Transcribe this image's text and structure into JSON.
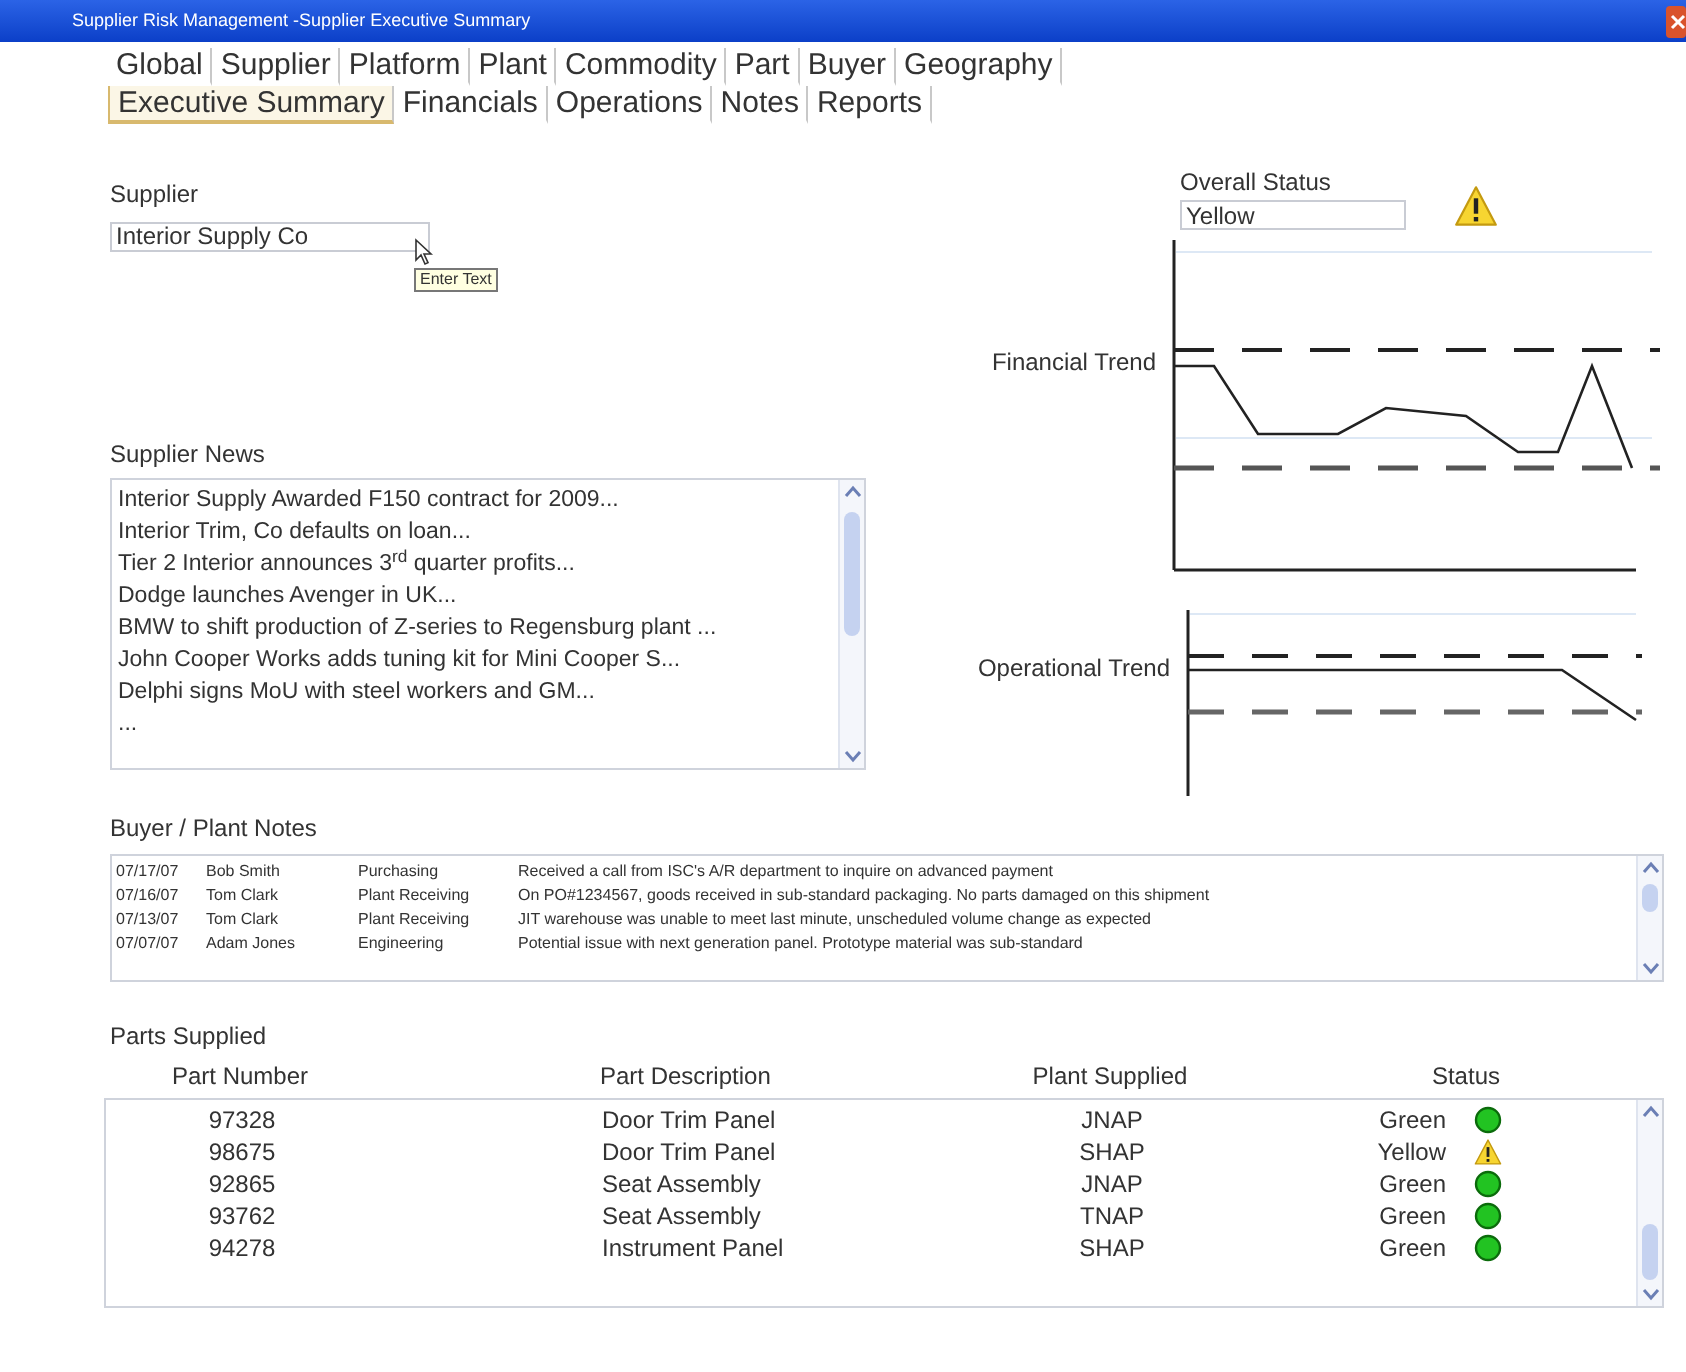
{
  "window": {
    "title": "Supplier Risk Management -Supplier Executive Summary"
  },
  "tab_rows": [
    {
      "tabs": [
        {
          "label": "Global",
          "selected": false
        },
        {
          "label": "Supplier",
          "selected": false
        },
        {
          "label": "Platform",
          "selected": false
        },
        {
          "label": "Plant",
          "selected": false
        },
        {
          "label": "Commodity",
          "selected": false
        },
        {
          "label": "Part",
          "selected": false
        },
        {
          "label": "Buyer",
          "selected": false
        },
        {
          "label": "Geography",
          "selected": false
        }
      ]
    },
    {
      "tabs": [
        {
          "label": "Executive Summary",
          "selected": true
        },
        {
          "label": "Financials",
          "selected": false
        },
        {
          "label": "Operations",
          "selected": false
        },
        {
          "label": "Notes",
          "selected": false
        },
        {
          "label": "Reports",
          "selected": false
        }
      ]
    }
  ],
  "supplier": {
    "label": "Supplier",
    "value": "Interior Supply Co",
    "tooltip": "Enter Text"
  },
  "overall_status": {
    "label": "Overall Status",
    "value": "Yellow",
    "kind": "warning"
  },
  "financial_trend": {
    "label": "Financial Trend"
  },
  "operational_trend": {
    "label": "Operational Trend"
  },
  "supplier_news": {
    "label": "Supplier News",
    "items": [
      "Interior Supply Awarded F150 contract for 2009...",
      "Interior Trim, Co defaults on loan...",
      "Tier 2 Interior announces 3$^{rd}$ quarter profits...",
      "Dodge launches Avenger in UK...",
      "BMW to shift production of Z-series to Regensburg plant ...",
      "John Cooper Works adds tuning kit for Mini Cooper S...",
      "Delphi signs MoU with steel workers and GM...",
      "..."
    ]
  },
  "buyer_plant_notes": {
    "label": "Buyer / Plant Notes",
    "rows": [
      {
        "date": "07/17/07",
        "name": "Bob Smith",
        "department": "Purchasing",
        "note": "Received a call from ISC's A/R department to inquire on advanced payment"
      },
      {
        "date": "07/16/07",
        "name": "Tom Clark",
        "department": "Plant Receiving",
        "note": "On PO#1234567, goods received in sub-standard packaging.  No parts damaged on this shipment"
      },
      {
        "date": "07/13/07",
        "name": "Tom Clark",
        "department": "Plant Receiving",
        "note": "JIT warehouse was unable to meet last minute, unscheduled volume change as expected"
      },
      {
        "date": "07/07/07",
        "name": "Adam Jones",
        "department": "Engineering",
        "note": "Potential issue with next generation panel. Prototype material was sub-standard"
      }
    ]
  },
  "parts_supplied": {
    "label": "Parts Supplied",
    "columns": [
      "Part Number",
      "Part Description",
      "Plant Supplied",
      "Status"
    ],
    "rows": [
      {
        "part_number": "97328",
        "description": "Door Trim Panel",
        "plant": "JNAP",
        "status": "Green",
        "kind": "ok"
      },
      {
        "part_number": "98675",
        "description": "Door Trim Panel",
        "plant": "SHAP",
        "status": "Yellow",
        "kind": "warning"
      },
      {
        "part_number": "92865",
        "description": "Seat Assembly",
        "plant": "JNAP",
        "status": "Green",
        "kind": "ok"
      },
      {
        "part_number": "93762",
        "description": "Seat Assembly",
        "plant": "TNAP",
        "status": "Green",
        "kind": "ok"
      },
      {
        "part_number": "94278",
        "description": "Instrument Panel",
        "plant": "SHAP",
        "status": "Green",
        "kind": "ok"
      }
    ]
  }
}
